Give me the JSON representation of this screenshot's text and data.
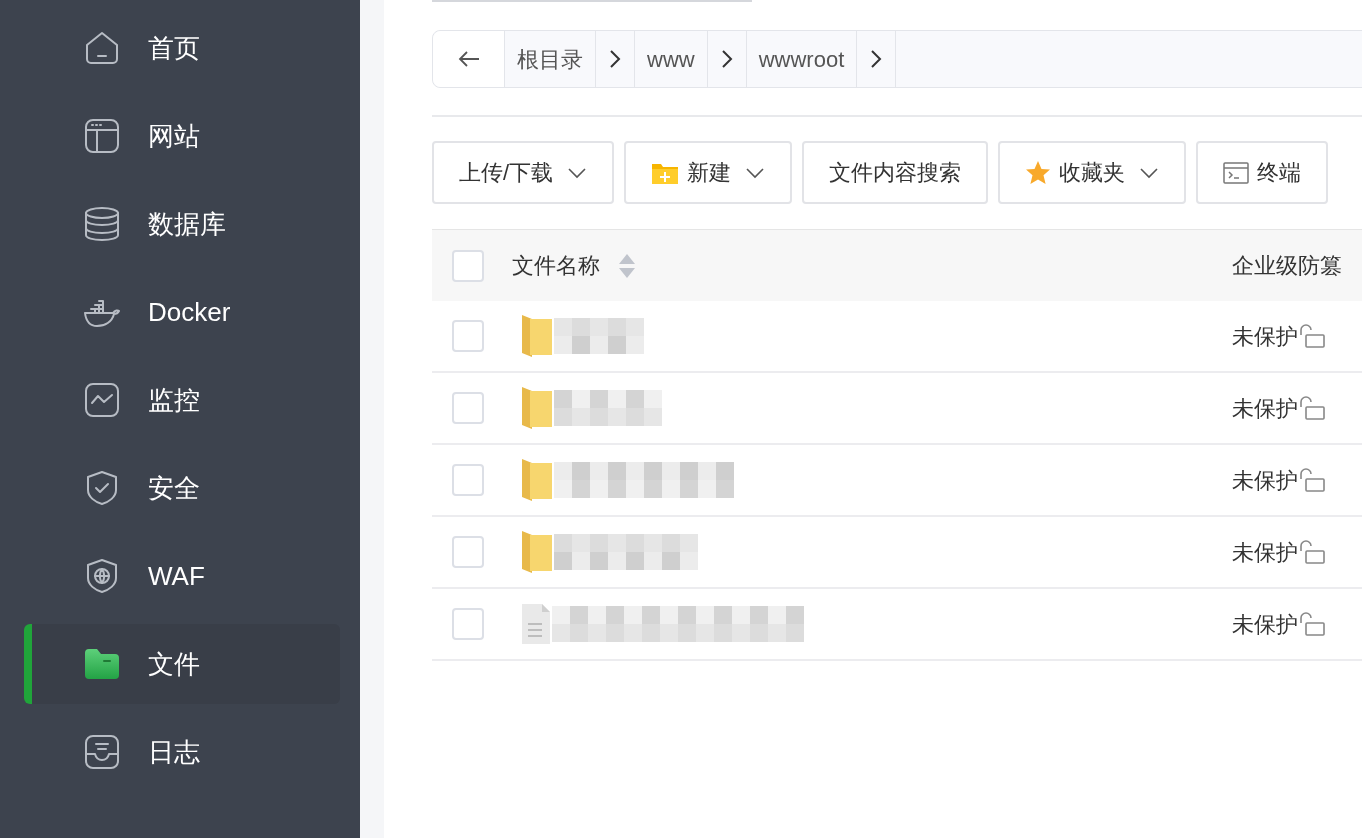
{
  "sidebar": {
    "items": [
      {
        "kind": "home",
        "label": "首页",
        "selected": false
      },
      {
        "kind": "website",
        "label": "网站",
        "selected": false
      },
      {
        "kind": "database",
        "label": "数据库",
        "selected": false
      },
      {
        "kind": "docker",
        "label": "Docker",
        "selected": false
      },
      {
        "kind": "monitor",
        "label": "监控",
        "selected": false
      },
      {
        "kind": "security",
        "label": "安全",
        "selected": false
      },
      {
        "kind": "waf",
        "label": "WAF",
        "selected": false
      },
      {
        "kind": "files",
        "label": "文件",
        "selected": true
      },
      {
        "kind": "logs",
        "label": "日志",
        "selected": false
      }
    ]
  },
  "breadcrumb": {
    "items": [
      "根目录",
      "www",
      "wwwroot"
    ]
  },
  "toolbar": [
    {
      "kind": "upload",
      "label": "上传/下载",
      "dropdown": true
    },
    {
      "kind": "new",
      "label": "新建",
      "dropdown": true
    },
    {
      "kind": "search",
      "label": "文件内容搜索",
      "dropdown": false
    },
    {
      "kind": "favorites",
      "label": "收藏夹",
      "dropdown": true
    },
    {
      "kind": "terminal",
      "label": "终端",
      "dropdown": false
    }
  ],
  "table": {
    "columns": [
      "文件名称",
      "企业级防篡"
    ],
    "select_all": {
      "checked": false
    },
    "rows": [
      {
        "kind": "folder",
        "checked": false,
        "protection": "未保护"
      },
      {
        "kind": "folder",
        "checked": false,
        "protection": "未保护"
      },
      {
        "kind": "folder",
        "checked": false,
        "protection": "未保护"
      },
      {
        "kind": "folder",
        "checked": false,
        "protection": "未保护"
      },
      {
        "kind": "file",
        "checked": false,
        "protection": "未保护"
      }
    ]
  }
}
